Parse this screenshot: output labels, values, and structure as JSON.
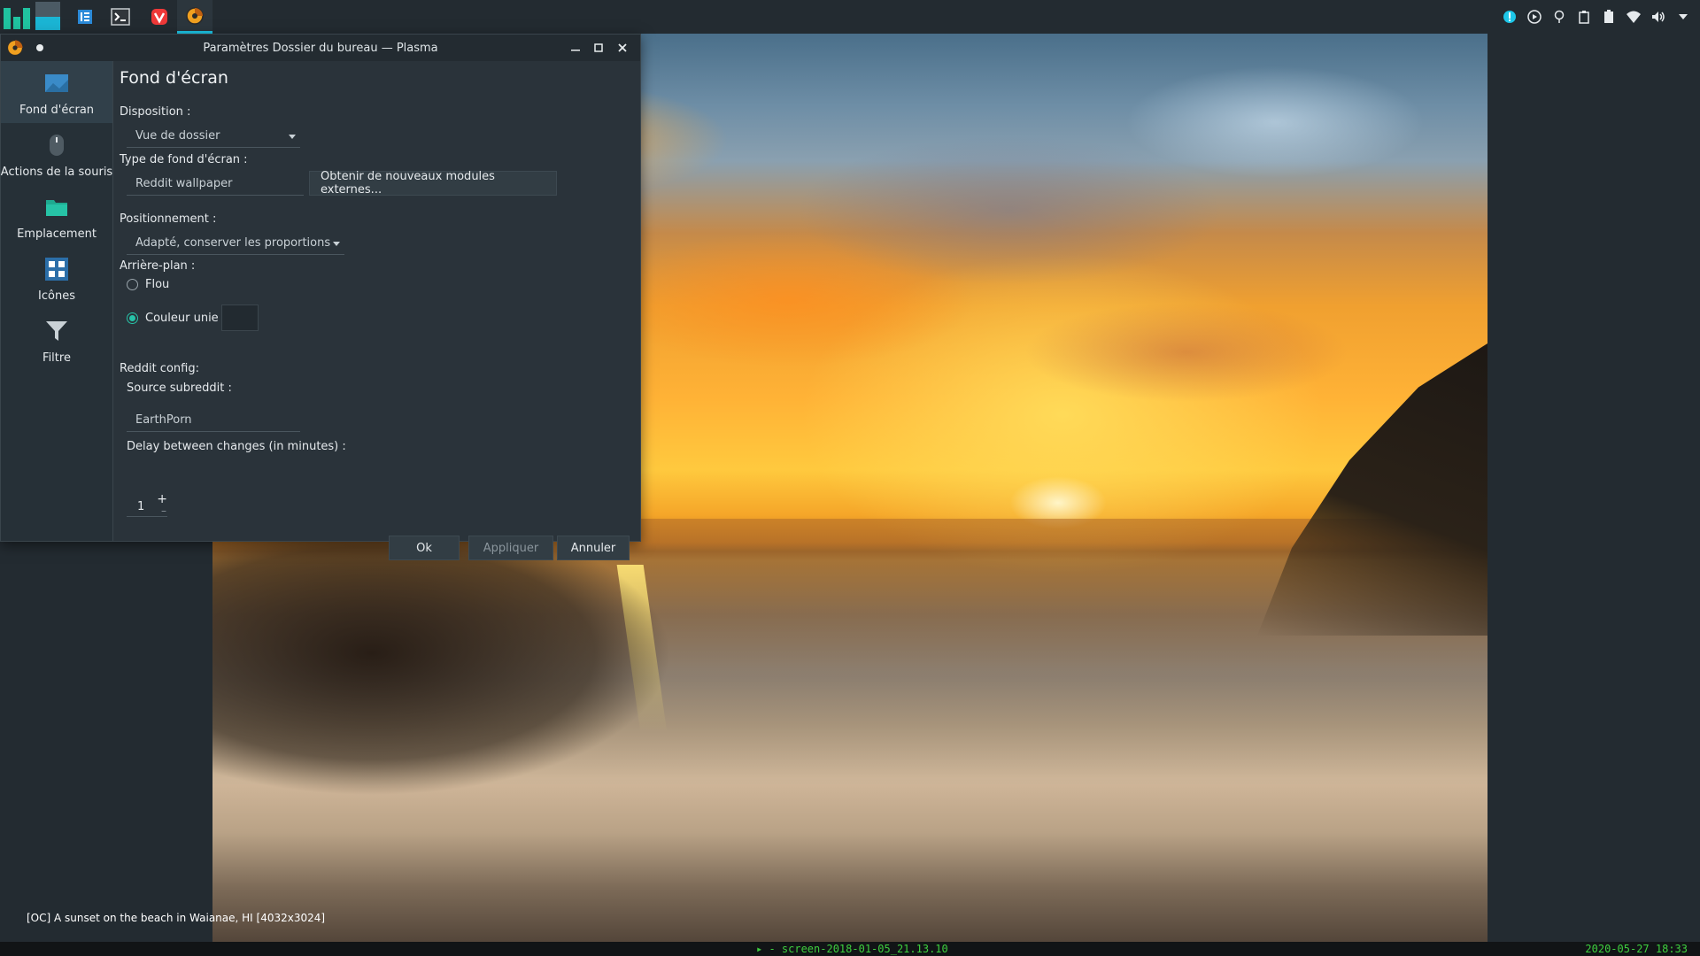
{
  "taskbar": {
    "tasks": [
      {
        "name": "file-manager"
      },
      {
        "name": "terminal"
      },
      {
        "name": "vivaldi"
      },
      {
        "name": "plasma-settings"
      }
    ],
    "tray_icons": [
      "notification-icon",
      "media-play-icon",
      "location-icon",
      "clipboard-icon",
      "battery-icon",
      "wifi-icon",
      "volume-icon",
      "tray-expand-icon"
    ]
  },
  "dialog": {
    "title": "Paramètres Dossier du bureau — Plasma",
    "sidebar": [
      {
        "label": "Fond d'écran",
        "icon": "wallpaper-icon",
        "active": true
      },
      {
        "label": "Actions de la souris",
        "icon": "mouse-icon",
        "active": false
      },
      {
        "label": "Emplacement",
        "icon": "folder-icon",
        "active": false
      },
      {
        "label": "Icônes",
        "icon": "icons-grid-icon",
        "active": false
      },
      {
        "label": "Filtre",
        "icon": "filter-icon",
        "active": false
      }
    ],
    "page_title": "Fond d'écran",
    "layout_label": "Disposition :",
    "layout_value": "Vue de dossier",
    "wallpaper_type_label": "Type de fond d'écran :",
    "wallpaper_type_value": "Reddit wallpaper",
    "get_plugins_button": "Obtenir de nouveaux modules externes...",
    "positioning_label": "Positionnement :",
    "positioning_value": "Adapté, conserver les proportions",
    "background_label": "Arrière-plan :",
    "radio_blur": "Flou",
    "radio_solid": "Couleur unie",
    "solid_selected": true,
    "reddit_config_label": "Reddit config:",
    "source_label": "Source subreddit :",
    "source_value": "EarthPorn",
    "delay_label": "Delay between changes (in minutes) :",
    "delay_value": "1",
    "ok_button": "Ok",
    "apply_button": "Appliquer",
    "cancel_button": "Annuler"
  },
  "desktop": {
    "caption": "[OC] A sunset on the beach in Waianae, HI [4032x3024]"
  },
  "bottom_bar": {
    "center": "▸ - screen-2018-01-05_21.13.10",
    "right": "2020-05-27 18:33"
  },
  "colors": {
    "accent": "#1dc6e8",
    "teal": "#27c3a8",
    "status_green": "#3ecf3e"
  }
}
